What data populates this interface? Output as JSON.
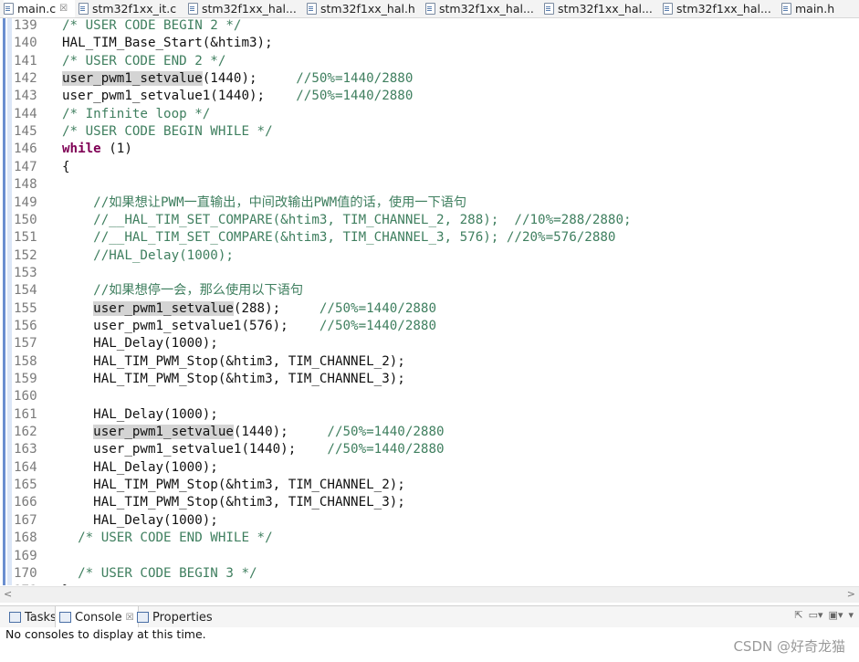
{
  "tabs": [
    {
      "label": "main.c",
      "close": "☒",
      "active": true
    },
    {
      "label": "stm32f1xx_it.c"
    },
    {
      "label": "stm32f1xx_hal..."
    },
    {
      "label": "stm32f1xx_hal.h"
    },
    {
      "label": "stm32f1xx_hal..."
    },
    {
      "label": "stm32f1xx_hal..."
    },
    {
      "label": "stm32f1xx_hal..."
    },
    {
      "label": "main.h"
    }
  ],
  "lines": [
    {
      "n": "139",
      "parts": [
        {
          "t": "/* USER CODE BEGIN 2 */",
          "c": "com"
        }
      ]
    },
    {
      "n": "140",
      "parts": [
        {
          "t": "HAL_TIM_Base_Start(&htim3);"
        }
      ]
    },
    {
      "n": "141",
      "parts": [
        {
          "t": "/* USER CODE END 2 */",
          "c": "com"
        }
      ]
    },
    {
      "n": "142",
      "parts": [
        {
          "t": "user_pwm1_setvalue",
          "c": "hl"
        },
        {
          "t": "(1440);     "
        },
        {
          "t": "//50%=1440/2880",
          "c": "com"
        }
      ]
    },
    {
      "n": "143",
      "parts": [
        {
          "t": "user_pwm1_setvalue1(1440);    "
        },
        {
          "t": "//50%=1440/2880",
          "c": "com"
        }
      ]
    },
    {
      "n": "144",
      "parts": [
        {
          "t": "/* Infinite loop */",
          "c": "com"
        }
      ]
    },
    {
      "n": "145",
      "parts": [
        {
          "t": "/* USER CODE BEGIN WHILE */",
          "c": "com"
        }
      ]
    },
    {
      "n": "146",
      "parts": [
        {
          "t": "while",
          "c": "kw"
        },
        {
          "t": " (1)"
        }
      ]
    },
    {
      "n": "147",
      "parts": [
        {
          "t": "{"
        }
      ]
    },
    {
      "n": "148",
      "parts": []
    },
    {
      "n": "149",
      "parts": [
        {
          "t": "    //如果想让PWM一直输出，中间改输出PWM值的话，使用一下语句",
          "c": "com"
        }
      ]
    },
    {
      "n": "150",
      "parts": [
        {
          "t": "    //__HAL_TIM_SET_COMPARE(&htim3, TIM_CHANNEL_2, 288);  //10%=288/2880;",
          "c": "com"
        }
      ]
    },
    {
      "n": "151",
      "parts": [
        {
          "t": "    //__HAL_TIM_SET_COMPARE(&htim3, TIM_CHANNEL_3, 576); //20%=576/2880",
          "c": "com"
        }
      ]
    },
    {
      "n": "152",
      "parts": [
        {
          "t": "    //HAL_Delay(1000);",
          "c": "com"
        }
      ]
    },
    {
      "n": "153",
      "parts": []
    },
    {
      "n": "154",
      "parts": [
        {
          "t": "    //如果想停一会，那么使用以下语句",
          "c": "com"
        }
      ]
    },
    {
      "n": "155",
      "parts": [
        {
          "t": "    "
        },
        {
          "t": "user_pwm1_setvalue",
          "c": "hl"
        },
        {
          "t": "(288);     "
        },
        {
          "t": "//50%=1440/2880",
          "c": "com"
        }
      ]
    },
    {
      "n": "156",
      "parts": [
        {
          "t": "    user_pwm1_setvalue1(576);    "
        },
        {
          "t": "//50%=1440/2880",
          "c": "com"
        }
      ]
    },
    {
      "n": "157",
      "parts": [
        {
          "t": "    HAL_Delay(1000);"
        }
      ]
    },
    {
      "n": "158",
      "parts": [
        {
          "t": "    HAL_TIM_PWM_Stop(&htim3, TIM_CHANNEL_2);"
        }
      ]
    },
    {
      "n": "159",
      "parts": [
        {
          "t": "    HAL_TIM_PWM_Stop(&htim3, TIM_CHANNEL_3);"
        }
      ]
    },
    {
      "n": "160",
      "parts": []
    },
    {
      "n": "161",
      "parts": [
        {
          "t": "    HAL_Delay(1000);"
        }
      ]
    },
    {
      "n": "162",
      "parts": [
        {
          "t": "    "
        },
        {
          "t": "user_pwm1_setvalue",
          "c": "hl"
        },
        {
          "t": "(1440);     "
        },
        {
          "t": "//50%=1440/2880",
          "c": "com"
        }
      ]
    },
    {
      "n": "163",
      "parts": [
        {
          "t": "    user_pwm1_setvalue1(1440);    "
        },
        {
          "t": "//50%=1440/2880",
          "c": "com"
        }
      ]
    },
    {
      "n": "164",
      "parts": [
        {
          "t": "    HAL_Delay(1000);"
        }
      ]
    },
    {
      "n": "165",
      "parts": [
        {
          "t": "    HAL_TIM_PWM_Stop(&htim3, TIM_CHANNEL_2);"
        }
      ]
    },
    {
      "n": "166",
      "parts": [
        {
          "t": "    HAL_TIM_PWM_Stop(&htim3, TIM_CHANNEL_3);"
        }
      ]
    },
    {
      "n": "167",
      "parts": [
        {
          "t": "    HAL_Delay(1000);"
        }
      ]
    },
    {
      "n": "168",
      "parts": [
        {
          "t": "  /* USER CODE END WHILE */",
          "c": "com"
        }
      ]
    },
    {
      "n": "169",
      "parts": []
    },
    {
      "n": "170",
      "parts": [
        {
          "t": "  /* USER CODE BEGIN 3 */",
          "c": "com"
        }
      ]
    },
    {
      "n": "171",
      "parts": [
        {
          "t": "}"
        }
      ]
    }
  ],
  "bottom_tabs": [
    {
      "label": "Tasks"
    },
    {
      "label": "Console",
      "close": "☒",
      "active": true
    },
    {
      "label": "Properties"
    }
  ],
  "console": {
    "message": "No consoles to display at this time."
  },
  "watermark": "CSDN @好奇龙猫",
  "colors": {
    "comment": "#3f7f5f",
    "keyword": "#7f0055",
    "highlight": "#d4d4d4"
  }
}
